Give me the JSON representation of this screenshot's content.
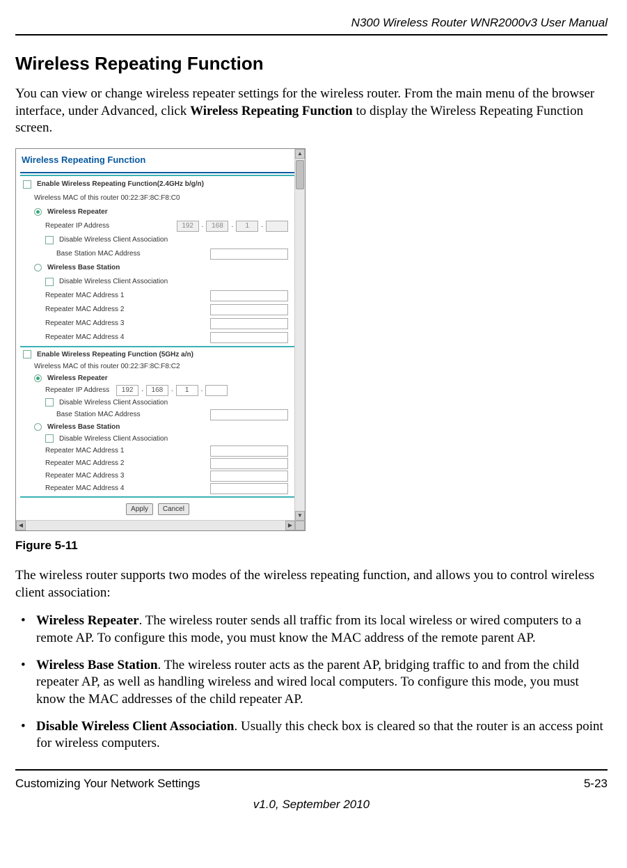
{
  "header": {
    "manual_title": "N300 Wireless Router WNR2000v3 User Manual"
  },
  "title": "Wireless Repeating Function",
  "intro_before_bold": "You can view or change wireless repeater settings for the wireless router. From the main menu of the browser interface, under Advanced, click ",
  "intro_bold": "Wireless Repeating Function",
  "intro_after_bold": " to display the Wireless Repeating Function screen.",
  "figure_caption": "Figure 5-11",
  "para2": "The wireless router supports two modes of the wireless repeating function, and allows you to control wireless client association:",
  "bullets": [
    {
      "term": "Wireless Repeater",
      "text": ". The wireless router sends all traffic from its local wireless or wired computers to a remote AP. To configure this mode, you must know the MAC address of the remote parent AP."
    },
    {
      "term": "Wireless Base Station",
      "text": ". The wireless router acts as the parent AP, bridging traffic to and from the child repeater AP, as well as handling wireless and wired local computers. To configure this mode, you must know the MAC addresses of the child repeater AP."
    },
    {
      "term": "Disable Wireless Client Association",
      "text": ". Usually this check box is cleared so that the router is an access point for wireless computers."
    }
  ],
  "footer": {
    "left": "Customizing Your Network Settings",
    "right": "5-23",
    "version": "v1.0, September 2010"
  },
  "screenshot": {
    "panel_title": "Wireless Repeating Function",
    "section24": {
      "enable_label": "Enable Wireless Repeating Function(2.4GHz b/g/n)",
      "mac_line": "Wireless MAC of this router 00:22:3F:8C:F8:C0",
      "repeater_label": "Wireless Repeater",
      "repeater_ip_label": "Repeater IP Address",
      "ip": [
        "192",
        "168",
        "1",
        ""
      ],
      "disable_assoc": "Disable Wireless Client Association",
      "base_mac_label": "Base Station MAC Address",
      "base_station_label": "Wireless Base Station",
      "rmac1": "Repeater MAC Address 1",
      "rmac2": "Repeater MAC Address 2",
      "rmac3": "Repeater MAC Address 3",
      "rmac4": "Repeater MAC Address 4"
    },
    "section5": {
      "enable_label": "Enable Wireless Repeating Function (5GHz a/n)",
      "mac_line": "Wireless MAC of this router 00:22:3F:8C:F8:C2",
      "repeater_label": "Wireless Repeater",
      "repeater_ip_label": "Repeater IP Address",
      "ip": [
        "192",
        "168",
        "1",
        ""
      ],
      "disable_assoc": "Disable Wireless Client Association",
      "base_mac_label": "Base Station MAC Address",
      "base_station_label": "Wireless Base Station",
      "rmac1": "Repeater MAC Address 1",
      "rmac2": "Repeater MAC Address 2",
      "rmac3": "Repeater MAC Address 3",
      "rmac4": "Repeater MAC Address 4"
    },
    "apply": "Apply",
    "cancel": "Cancel"
  }
}
